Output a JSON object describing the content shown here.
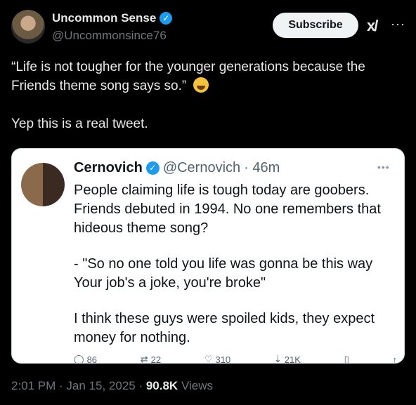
{
  "author": {
    "name": "Uncommon Sense",
    "handle": "@Uncommonsince76",
    "subscribe_label": "Subscribe",
    "grok_icon": "xai-icon",
    "more_icon": "more-icon"
  },
  "tweet": {
    "line1": "“Life is not tougher for the younger generations because the Friends theme song says so.”",
    "emoji": "tears-of-joy-emoji",
    "line2": "Yep this is a real tweet."
  },
  "quoted": {
    "name": "Cernovich",
    "handle": "@Cernovich",
    "time": "· 46m",
    "para1": "People claiming life is tough today are goobers. Friends debuted in 1994. No one remembers that hideous theme song?",
    "para2": "- \"So no one told you life was gonna be this way Your job's a joke, you're broke\"",
    "para3": "I think these guys were spoiled kids, they expect money for nothing.",
    "actions": {
      "reply": "86",
      "retweet": "22",
      "like": "310",
      "views": "21K"
    }
  },
  "footer": {
    "timestamp": "2:01 PM · Jan 15, 2025 ·",
    "views_count": "90.8K",
    "views_label": "Views"
  },
  "colors": {
    "background": "#000000",
    "verified": "#1d9bf0",
    "muted": "#71767b"
  }
}
